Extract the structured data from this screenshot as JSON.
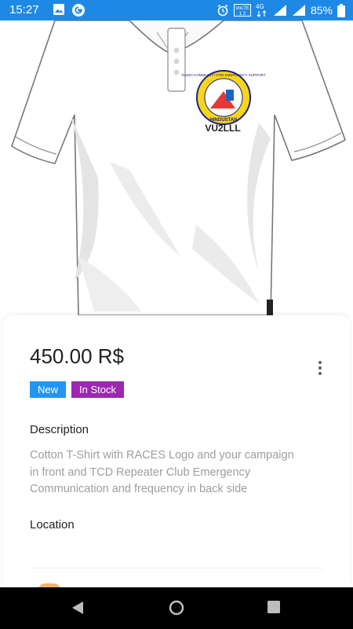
{
  "status_bar": {
    "time": "15:27",
    "battery": "85%",
    "network": "4G",
    "volte": "VoLTE",
    "icons": [
      "image-icon",
      "google-icon",
      "alarm-icon",
      "volte-icon",
      "network-4g-icon",
      "signal-icon",
      "signal-icon",
      "battery-icon"
    ]
  },
  "product_image": {
    "logo_text": "VU2LLL",
    "logo_ring_text": "RADIO COMMUNITY FOR EMERGENCY SUPPORT",
    "logo_bottom_text": "HINDUSTAN",
    "carousel": {
      "count": 3,
      "active": 1
    }
  },
  "product": {
    "price": "450.00 R$",
    "badges": [
      {
        "label": "New",
        "color": "#2196f3"
      },
      {
        "label": "In Stock",
        "color": "#9c27b0"
      }
    ],
    "description_title": "Description",
    "description_lines": [
      "Cotton T-Shirt with RACES Logo and your campaign",
      "in front and TCD Repeater Club Emergency",
      "Communication and frequency in back side"
    ],
    "location_title": "Location"
  },
  "colors": {
    "status_bar": "#1e88e5",
    "badge_new": "#2196f3",
    "badge_in_stock": "#9c27b0",
    "nav_bar": "#000000"
  },
  "navigation": {
    "buttons": [
      "back-icon",
      "home-icon",
      "recents-icon"
    ]
  }
}
